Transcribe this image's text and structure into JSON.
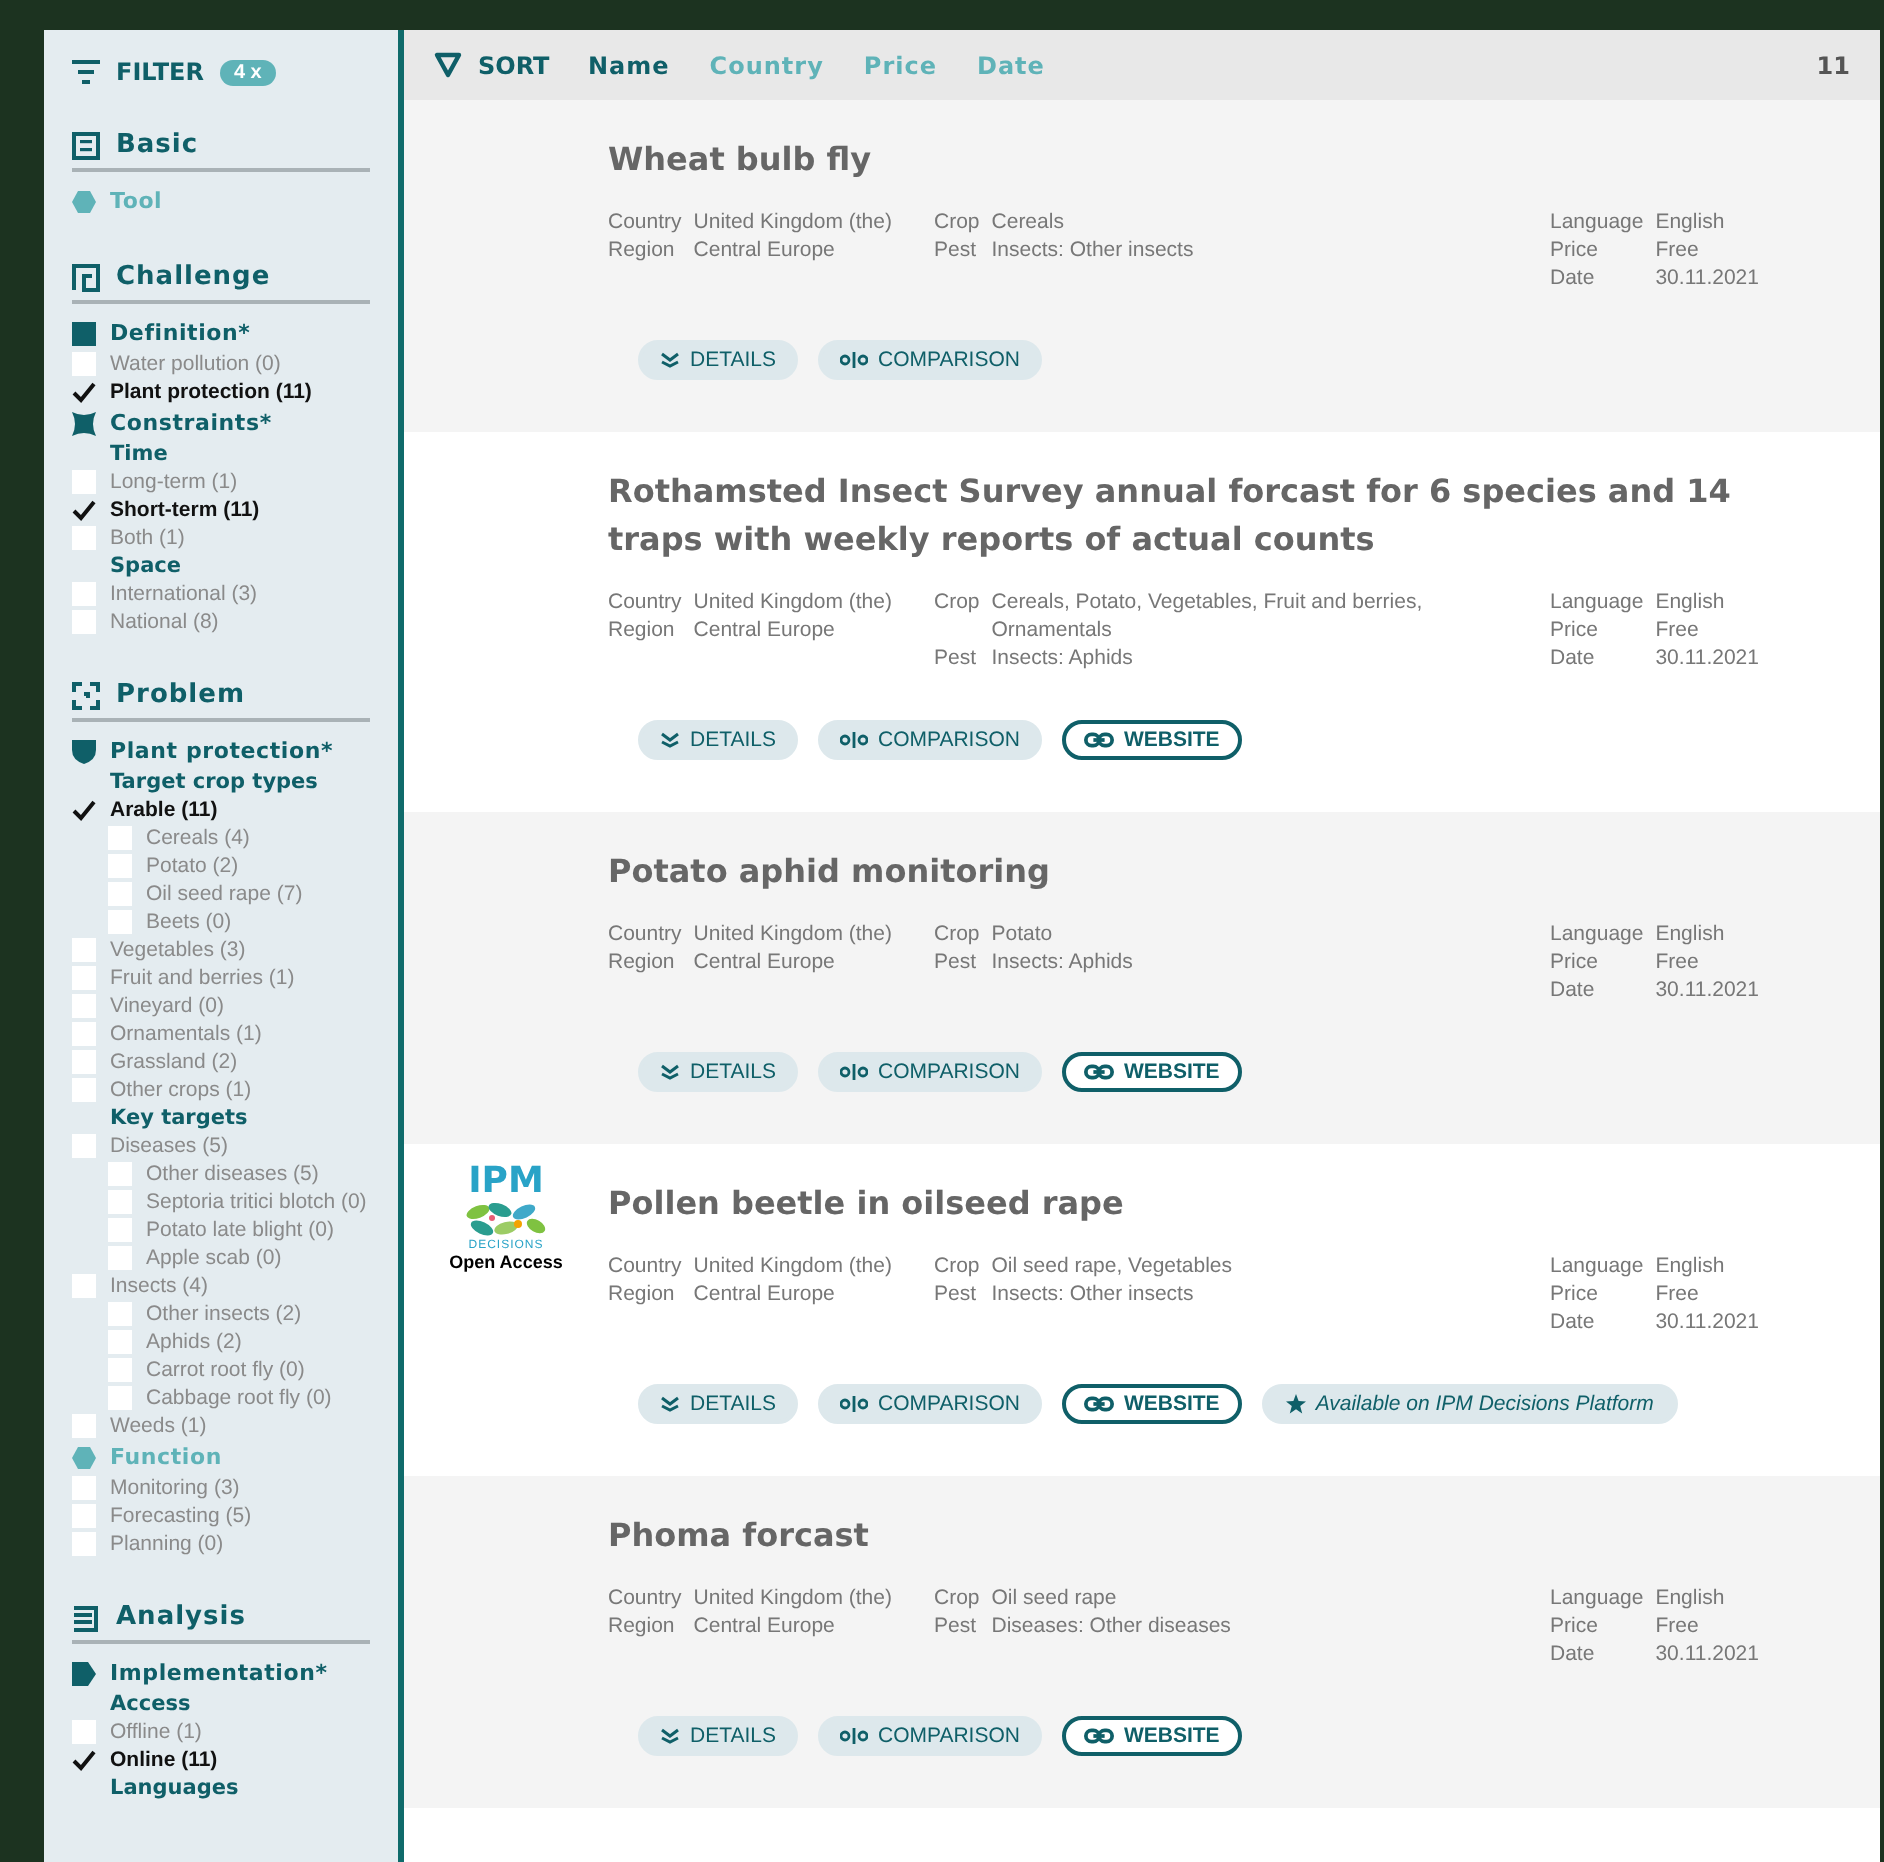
{
  "sidebar": {
    "title": "FILTER",
    "badge": "4 x",
    "sections": [
      {
        "title": "Basic",
        "entries": [
          {
            "kind": "category",
            "label": "Tool",
            "active": false
          }
        ]
      },
      {
        "title": "Challenge",
        "entries": [
          {
            "kind": "category",
            "label": "Definition*",
            "active": true
          },
          {
            "kind": "option",
            "label": "Water pollution (0)",
            "checked": false
          },
          {
            "kind": "option",
            "label": "Plant protection (11)",
            "checked": true
          },
          {
            "kind": "category",
            "label": "Constraints*",
            "active": true
          },
          {
            "kind": "subheading",
            "label": "Time"
          },
          {
            "kind": "option",
            "label": "Long-term (1)",
            "checked": false
          },
          {
            "kind": "option",
            "label": "Short-term (11)",
            "checked": true
          },
          {
            "kind": "option",
            "label": "Both (1)",
            "checked": false
          },
          {
            "kind": "subheading",
            "label": "Space"
          },
          {
            "kind": "option",
            "label": "International (3)",
            "checked": false
          },
          {
            "kind": "option",
            "label": "National (8)",
            "checked": false
          }
        ]
      },
      {
        "title": "Problem",
        "entries": [
          {
            "kind": "category",
            "label": "Plant protection*",
            "active": true
          },
          {
            "kind": "subheading",
            "label": "Target crop types"
          },
          {
            "kind": "option",
            "label": "Arable (11)",
            "checked": true,
            "children": [
              {
                "label": "Cereals (4)",
                "checked": false
              },
              {
                "label": "Potato (2)",
                "checked": false
              },
              {
                "label": "Oil seed rape (7)",
                "checked": false
              },
              {
                "label": "Beets (0)",
                "checked": false
              }
            ]
          },
          {
            "kind": "option",
            "label": "Vegetables (3)",
            "checked": false
          },
          {
            "kind": "option",
            "label": "Fruit and berries (1)",
            "checked": false
          },
          {
            "kind": "option",
            "label": "Vineyard (0)",
            "checked": false
          },
          {
            "kind": "option",
            "label": "Ornamentals (1)",
            "checked": false
          },
          {
            "kind": "option",
            "label": "Grassland (2)",
            "checked": false
          },
          {
            "kind": "option",
            "label": "Other crops (1)",
            "checked": false
          },
          {
            "kind": "subheading",
            "label": "Key targets"
          },
          {
            "kind": "option",
            "label": "Diseases (5)",
            "checked": false,
            "children": [
              {
                "label": "Other diseases (5)",
                "checked": false
              },
              {
                "label": "Septoria tritici blotch (0)",
                "checked": false
              },
              {
                "label": "Potato late blight (0)",
                "checked": false
              },
              {
                "label": "Apple scab (0)",
                "checked": false
              }
            ]
          },
          {
            "kind": "option",
            "label": "Insects (4)",
            "checked": false,
            "children": [
              {
                "label": "Other insects (2)",
                "checked": false
              },
              {
                "label": "Aphids (2)",
                "checked": false
              },
              {
                "label": "Carrot root fly (0)",
                "checked": false
              },
              {
                "label": "Cabbage root fly (0)",
                "checked": false
              }
            ]
          },
          {
            "kind": "option",
            "label": "Weeds (1)",
            "checked": false
          },
          {
            "kind": "category",
            "label": "Function",
            "active": false
          },
          {
            "kind": "option",
            "label": "Monitoring (3)",
            "checked": false
          },
          {
            "kind": "option",
            "label": "Forecasting (5)",
            "checked": false
          },
          {
            "kind": "option",
            "label": "Planning (0)",
            "checked": false
          }
        ]
      },
      {
        "title": "Analysis",
        "entries": [
          {
            "kind": "category",
            "label": "Implementation*",
            "active": true
          },
          {
            "kind": "subheading",
            "label": "Access"
          },
          {
            "kind": "option",
            "label": "Offline (1)",
            "checked": false
          },
          {
            "kind": "option",
            "label": "Online (11)",
            "checked": true
          },
          {
            "kind": "subheading",
            "label": "Languages"
          }
        ]
      }
    ]
  },
  "sort": {
    "label": "SORT",
    "options": [
      {
        "label": "Name",
        "selected": true
      },
      {
        "label": "Country",
        "selected": false
      },
      {
        "label": "Price",
        "selected": false
      },
      {
        "label": "Date",
        "selected": false
      }
    ],
    "count": "11"
  },
  "cards": [
    {
      "title": "Wheat bulb fly",
      "meta": [
        [
          {
            "label": "Country",
            "value": "United Kingdom (the)"
          },
          {
            "label": "Region",
            "value": "Central Europe"
          }
        ],
        [
          {
            "label": "Crop",
            "value": "Cereals"
          },
          {
            "label": "Pest",
            "value": "Insects: Other insects"
          }
        ],
        [
          {
            "label": "Language",
            "value": "English"
          },
          {
            "label": "Price",
            "value": "Free"
          },
          {
            "label": "Date",
            "value": "30.11.2021"
          }
        ]
      ],
      "buttons": [
        {
          "kind": "details",
          "label": "DETAILS"
        },
        {
          "kind": "comparison",
          "label": "COMPARISON"
        }
      ]
    },
    {
      "title": "Rothamsted Insect Survey annual forcast for 6 species and 14 traps with weekly reports of actual counts",
      "meta": [
        [
          {
            "label": "Country",
            "value": "United Kingdom (the)"
          },
          {
            "label": "Region",
            "value": "Central Europe"
          }
        ],
        [
          {
            "label": "Crop",
            "value": "Cereals, Potato, Vegetables, Fruit and berries, Ornamentals"
          },
          {
            "label": "Pest",
            "value": "Insects: Aphids"
          }
        ],
        [
          {
            "label": "Language",
            "value": "English"
          },
          {
            "label": "Price",
            "value": "Free"
          },
          {
            "label": "Date",
            "value": "30.11.2021"
          }
        ]
      ],
      "buttons": [
        {
          "kind": "details",
          "label": "DETAILS"
        },
        {
          "kind": "comparison",
          "label": "COMPARISON"
        },
        {
          "kind": "website",
          "label": "WEBSITE"
        }
      ]
    },
    {
      "title": "Potato aphid monitoring",
      "meta": [
        [
          {
            "label": "Country",
            "value": "United Kingdom (the)"
          },
          {
            "label": "Region",
            "value": "Central Europe"
          }
        ],
        [
          {
            "label": "Crop",
            "value": "Potato"
          },
          {
            "label": "Pest",
            "value": "Insects: Aphids"
          }
        ],
        [
          {
            "label": "Language",
            "value": "English"
          },
          {
            "label": "Price",
            "value": "Free"
          },
          {
            "label": "Date",
            "value": "30.11.2021"
          }
        ]
      ],
      "buttons": [
        {
          "kind": "details",
          "label": "DETAILS"
        },
        {
          "kind": "comparison",
          "label": "COMPARISON"
        },
        {
          "kind": "website",
          "label": "WEBSITE"
        }
      ]
    },
    {
      "logo": {
        "title": "IPM",
        "subtitle": "DECISIONS",
        "caption": "Open Access"
      },
      "title": "Pollen beetle in oilseed rape",
      "meta": [
        [
          {
            "label": "Country",
            "value": "United Kingdom (the)"
          },
          {
            "label": "Region",
            "value": "Central Europe"
          }
        ],
        [
          {
            "label": "Crop",
            "value": "Oil seed rape, Vegetables"
          },
          {
            "label": "Pest",
            "value": "Insects: Other insects"
          }
        ],
        [
          {
            "label": "Language",
            "value": "English"
          },
          {
            "label": "Price",
            "value": "Free"
          },
          {
            "label": "Date",
            "value": "30.11.2021"
          }
        ]
      ],
      "buttons": [
        {
          "kind": "details",
          "label": "DETAILS"
        },
        {
          "kind": "comparison",
          "label": "COMPARISON"
        },
        {
          "kind": "website",
          "label": "WEBSITE"
        },
        {
          "kind": "platform",
          "label": "Available on IPM Decisions Platform"
        }
      ]
    },
    {
      "title": "Phoma forcast",
      "meta": [
        [
          {
            "label": "Country",
            "value": "United Kingdom (the)"
          },
          {
            "label": "Region",
            "value": "Central Europe"
          }
        ],
        [
          {
            "label": "Crop",
            "value": "Oil seed rape"
          },
          {
            "label": "Pest",
            "value": "Diseases: Other diseases"
          }
        ],
        [
          {
            "label": "Language",
            "value": "English"
          },
          {
            "label": "Price",
            "value": "Free"
          },
          {
            "label": "Date",
            "value": "30.11.2021"
          }
        ]
      ],
      "buttons": [
        {
          "kind": "details",
          "label": "DETAILS"
        },
        {
          "kind": "comparison",
          "label": "COMPARISON"
        },
        {
          "kind": "website",
          "label": "WEBSITE"
        }
      ]
    }
  ]
}
